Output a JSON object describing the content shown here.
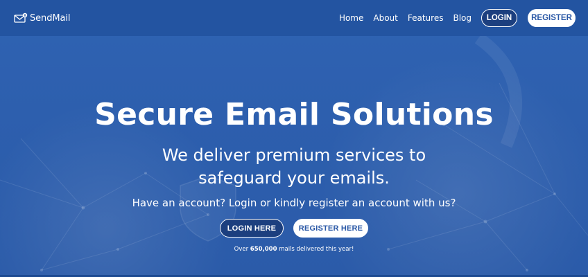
{
  "brand": {
    "name": "SendMail",
    "logo_icon": "envelope-icon"
  },
  "nav": {
    "links": [
      "Home",
      "About",
      "Features",
      "Blog"
    ],
    "login_label": "LOGIN",
    "register_label": "REGISTER"
  },
  "hero": {
    "title": "Secure Email Solutions",
    "subtitle": "We deliver premium services to safeguard your emails.",
    "prompt": "Have an account? Login or kindly register an account with us?",
    "login_button": "LOGIN HERE",
    "register_button": "REGISTER HERE",
    "note_prefix": "Over ",
    "note_count": "650,000",
    "note_suffix": " mails delivered this year!"
  },
  "colors": {
    "background": "#2d5fae",
    "navbar": "#2352a0",
    "button_dark": "#1c3f7f",
    "button_light": "#ffffff",
    "text": "#ffffff"
  }
}
